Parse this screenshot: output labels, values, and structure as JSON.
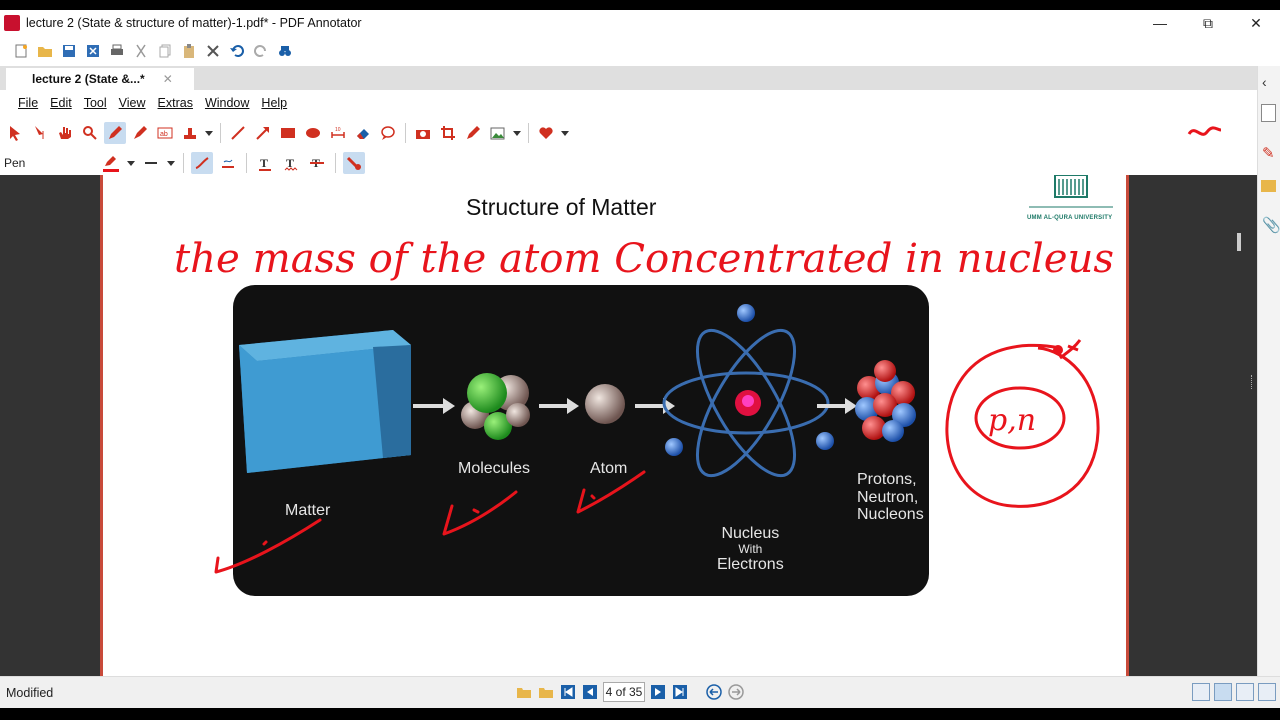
{
  "window": {
    "title": "lecture 2 (State & structure of matter)-1.pdf* - PDF Annotator"
  },
  "tab": {
    "label": "lecture 2 (State &...*",
    "close": "✕"
  },
  "menu": [
    "File",
    "Edit",
    "Tool",
    "View",
    "Extras",
    "Window",
    "Help"
  ],
  "toolbar": {
    "current_tool": "Pen",
    "stamp_number": "10"
  },
  "slide": {
    "title": "Structure of Matter",
    "logo_text": "UMM AL-QURA UNIVERSITY",
    "diagram_labels": {
      "matter": "Matter",
      "molecules": "Molecules",
      "atom": "Atom",
      "nucleus_line1": "Nucleus",
      "nucleus_line2": "With",
      "nucleus_line3": "Electrons",
      "particles_line1": "Protons,",
      "particles_line2": "Neutron,",
      "particles_line3": "Nucleons"
    }
  },
  "annotations": {
    "handwritten_sentence": "the mass of the atom Concentrated in nucleus",
    "circle_label": "p,n"
  },
  "status": {
    "text": "Modified",
    "page_display": "4 of 35"
  },
  "colors": {
    "accent_red": "#e8141c",
    "diagram_bg": "#111111",
    "cube": "#4aa8d8"
  }
}
